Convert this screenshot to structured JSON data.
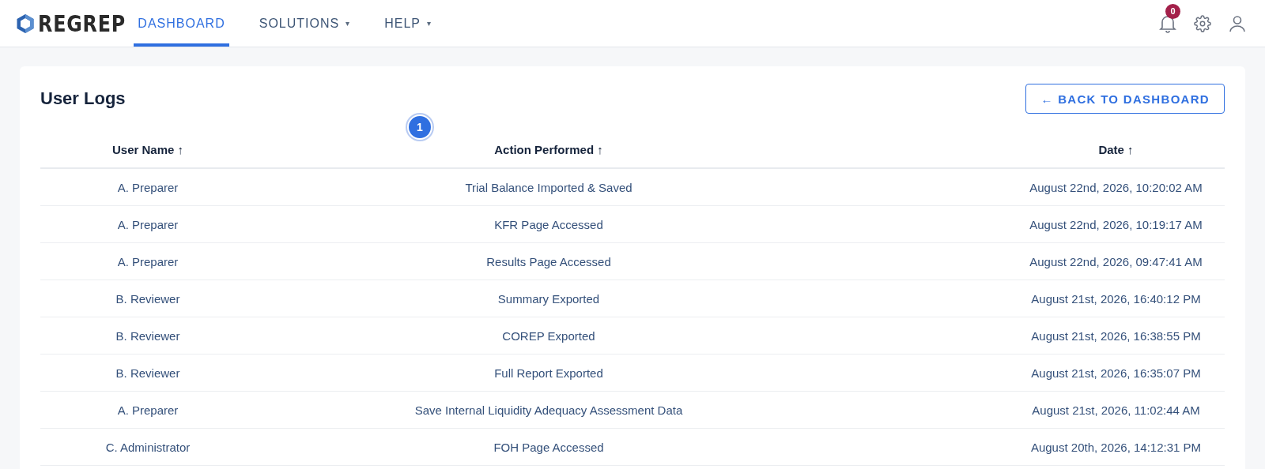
{
  "navbar": {
    "logo": "REGREP",
    "nav_items": [
      {
        "label": "DASHBOARD",
        "selected": true
      },
      {
        "label": "SOLUTIONS",
        "selected": false,
        "caret": "▾"
      },
      {
        "label": "HELP",
        "selected": false,
        "caret": "▾"
      }
    ],
    "notifications_count": "0"
  },
  "card": {
    "title": "User Logs",
    "back_button": {
      "arrow": "←",
      "label": "BACK TO DASHBOARD"
    },
    "step_marker": "1",
    "table": {
      "columns": [
        {
          "label": "User Name",
          "sort": "↑"
        },
        {
          "label": "Action Performed",
          "sort": "↑"
        },
        {
          "label": "Date",
          "sort": "↑"
        }
      ],
      "rows": [
        [
          "A. Preparer",
          "Trial Balance Imported & Saved",
          "August 22nd, 2026, 10:20:02 AM"
        ],
        [
          "A. Preparer",
          "KFR Page Accessed",
          "August 22nd, 2026, 10:19:17 AM"
        ],
        [
          "A. Preparer",
          "Results Page Accessed",
          "August 22nd, 2026, 09:47:41 AM"
        ],
        [
          "B. Reviewer",
          "Summary Exported",
          "August 21st, 2026, 16:40:12 PM"
        ],
        [
          "B. Reviewer",
          "COREP Exported",
          "August 21st, 2026, 16:38:55 PM"
        ],
        [
          "B. Reviewer",
          "Full Report Exported",
          "August 21st, 2026, 16:35:07 PM"
        ],
        [
          "A. Preparer",
          "Save Internal Liquidity Adequacy Assessment Data",
          "August 21st, 2026, 11:02:44 AM"
        ],
        [
          "C. Administrator",
          "FOH Page Accessed",
          "August 20th, 2026, 14:12:31 PM"
        ]
      ]
    }
  }
}
